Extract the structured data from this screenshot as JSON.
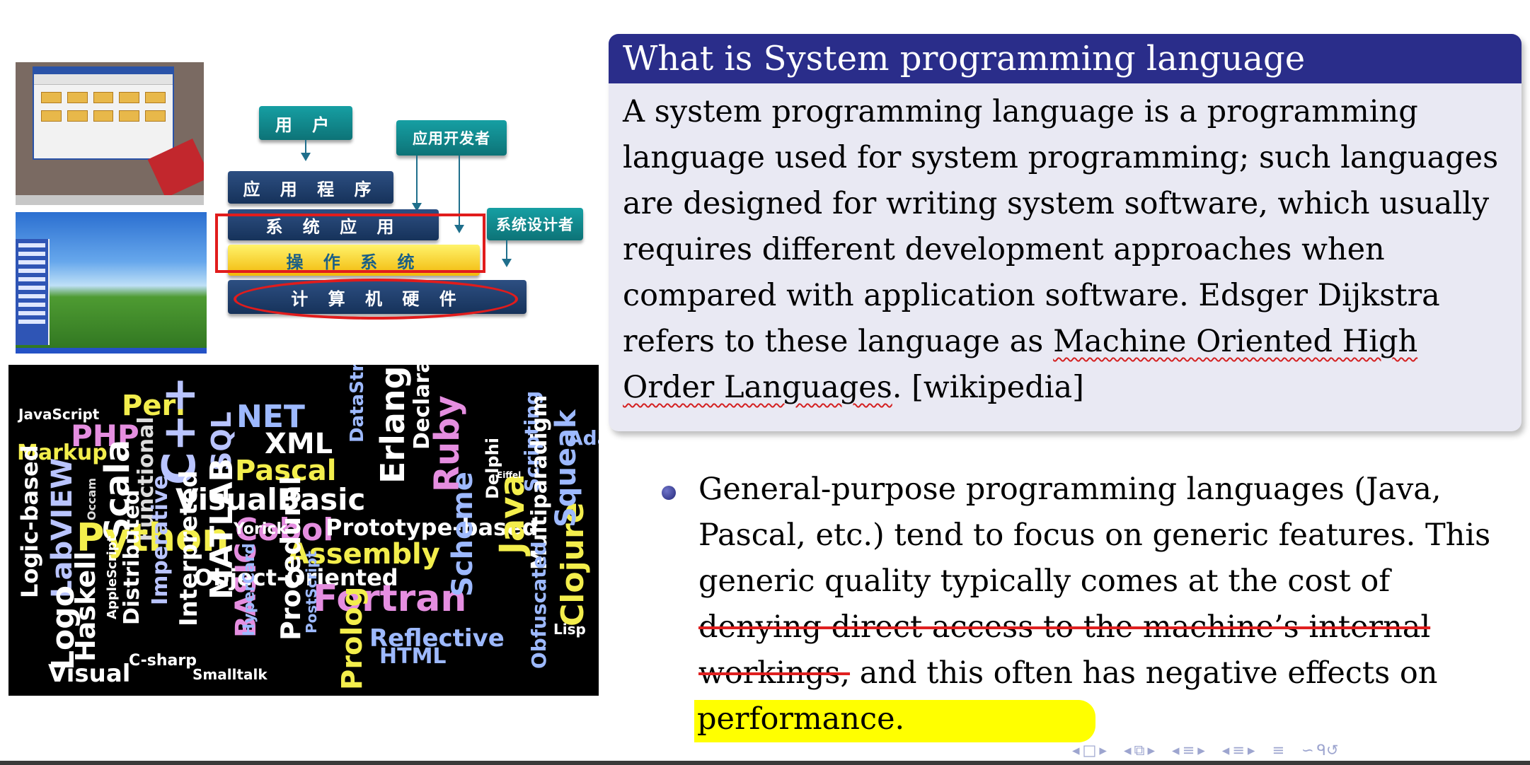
{
  "diagram": {
    "user": "用 户",
    "app_dev": "应用开发者",
    "application": "应 用 程 序",
    "sys_app": "系 统 应 用",
    "sys_designer": "系统设计者",
    "os": "操 作 系 统",
    "hardware": "计 算 机 硬 件"
  },
  "word_cloud": [
    "JavaScript",
    "Perl",
    "PHP",
    "Markup",
    "NET",
    "XML",
    "C++",
    "SQL",
    "Pascal",
    "VisualBasic",
    "Scala",
    "Functional",
    "Python",
    "Logic-based",
    "LabVIEW",
    "Haskell",
    "Logo",
    "Visual",
    "Cobol",
    "Prototype-based",
    "Assembly",
    "MATLAB",
    "BASIC",
    "Object-Oriented",
    "Fortran",
    "Prolog",
    "Reflective",
    "HTML",
    "Scheme",
    "Java",
    "Scripting",
    "Multiparadigm",
    "Clojure",
    "Squeak",
    "Ada",
    "Ruby",
    "Erlang",
    "Declarative",
    "DataStructured",
    "Delphi",
    "Obfuscated",
    "Lisp",
    "Smalltalk",
    "C-sharp",
    "Procedural",
    "Interpreted",
    "Imperative",
    "Distributed",
    "AppleScript",
    "PostScript",
    "HyperCard",
    "Yorick",
    "Occam",
    "Eiffel"
  ],
  "definition": {
    "title": "What is System programming language",
    "text_before": "A system programming language is a programming language used for system programming; such languages are designed for writing system software, which usually requires different development approaches when compared with application software. Edsger Dijkstra refers to these language as",
    "term": "Machine Oriented High Order Languages",
    "text_after": ". [wikipedia]"
  },
  "bullet": {
    "text_before": "General-purpose programming languages (Java, Pascal, etc.) tend to focus on generic features. This generic quality typically comes at the cost of",
    "struck": "denying direct access to the machine’s internal workings,",
    "text_middle": "and this often has negative effects on",
    "highlighted": "performance."
  },
  "nav": {
    "left_arrow": "◂",
    "right_arrow": "▸",
    "frame_icon": "□",
    "subsection_icon": "⧉",
    "section_icon": "≡",
    "align_icon": "≡",
    "search_icon": "∽",
    "search_glyphs": "ᑫ↺"
  },
  "colors": {
    "title_bar": "#2a2d8a",
    "block_body": "#e9e9f3",
    "highlight": "#ffff00",
    "strike": "#e02020",
    "diagram_teal": "#0d7377",
    "diagram_navy": "#16325a"
  }
}
